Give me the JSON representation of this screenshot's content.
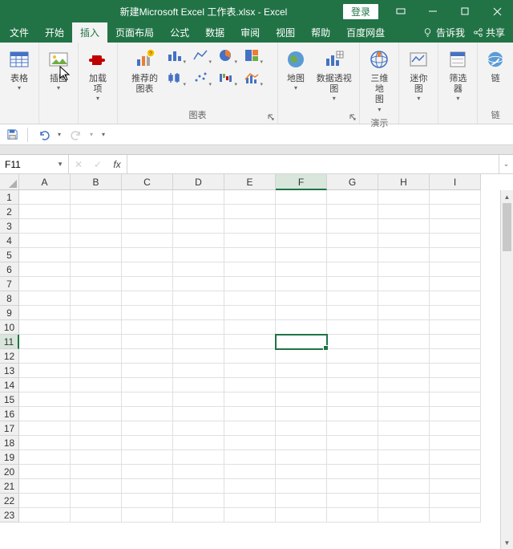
{
  "title": "新建Microsoft Excel 工作表.xlsx  -  Excel",
  "login": "登录",
  "menu": {
    "file": "文件",
    "home": "开始",
    "insert": "插入",
    "layout": "页面布局",
    "formulas": "公式",
    "data": "数据",
    "review": "审阅",
    "view": "视图",
    "help": "帮助",
    "baidu": "百度网盘",
    "tellme": "告诉我",
    "share": "共享"
  },
  "ribbon": {
    "tables": {
      "btn": "表格",
      "label": ""
    },
    "illustrations": {
      "btn": "插图",
      "label": ""
    },
    "addins": {
      "btn": "加载\n项",
      "label": ""
    },
    "recommended": "推荐的\n图表",
    "charts_label": "图表",
    "map": "地图",
    "pivotchart": "数据透视图",
    "map3d": {
      "btn": "三维地\n图",
      "label": "演示"
    },
    "sparklines": "迷你图",
    "filter": "筛选器",
    "links_btn": "链",
    "links_label": "链"
  },
  "name_box": "F11",
  "formula": "",
  "columns": [
    "A",
    "B",
    "C",
    "D",
    "E",
    "F",
    "G",
    "H",
    "I"
  ],
  "rows": [
    "1",
    "2",
    "3",
    "4",
    "5",
    "6",
    "7",
    "8",
    "9",
    "10",
    "11",
    "12",
    "13",
    "14",
    "15",
    "16",
    "17",
    "18",
    "19",
    "20",
    "21",
    "22",
    "23"
  ],
  "active": {
    "col": 5,
    "row": 10
  }
}
